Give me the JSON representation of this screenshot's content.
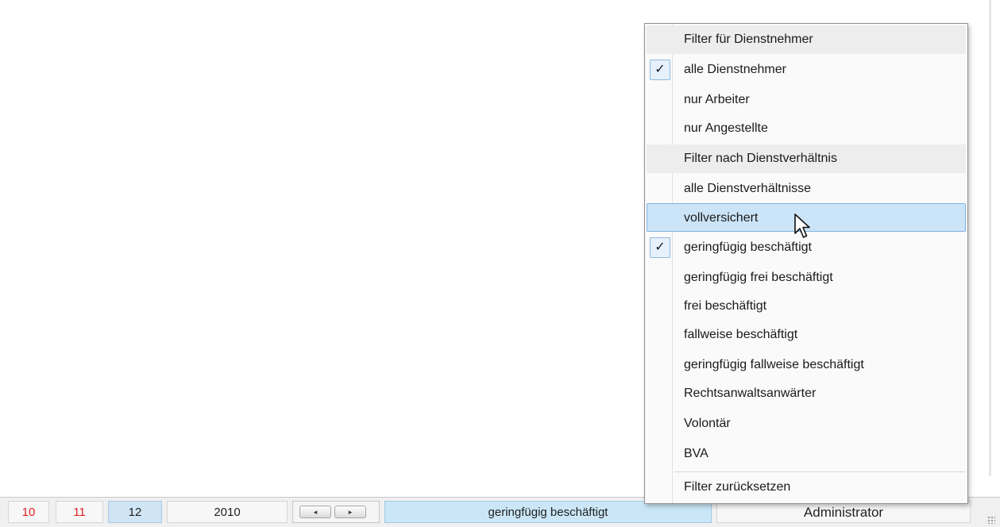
{
  "statusbar": {
    "cell_10": "10",
    "cell_11": "11",
    "cell_12": "12",
    "year": "2010",
    "nav_prev_icon": "triangle-left-icon",
    "nav_next_icon": "triangle-right-icon",
    "nav_prev": "◂",
    "nav_next": "▸",
    "active_filter": "geringfügig beschäftigt",
    "user": "Administrator"
  },
  "menu": {
    "header_employees": "Filter für Dienstnehmer",
    "all_employees": "alle Dienstnehmer",
    "only_workers": "nur Arbeiter",
    "only_employees": "nur Angestellte",
    "header_employment": "Filter nach Dienstverhältnis",
    "all_employment": "alle Dienstverhältnisse",
    "fully_insured": "vollversichert",
    "marginal": "geringfügig beschäftigt",
    "marginal_free": "geringfügig frei beschäftigt",
    "free": "frei beschäftigt",
    "occasional": "fallweise beschäftigt",
    "marginal_occasional": "geringfügig fallweise beschäftigt",
    "trainee_lawyer": "Rechtsanwaltsanwärter",
    "volunteer": "Volontär",
    "bva": "BVA",
    "reset": "Filter zurücksetzen",
    "check_glyph": "✓"
  },
  "colors": {
    "hover_bg": "#cce4f7",
    "hover_border": "#7fb2e0",
    "status_active": "#cbe7f7",
    "red_text": "#e02020"
  }
}
